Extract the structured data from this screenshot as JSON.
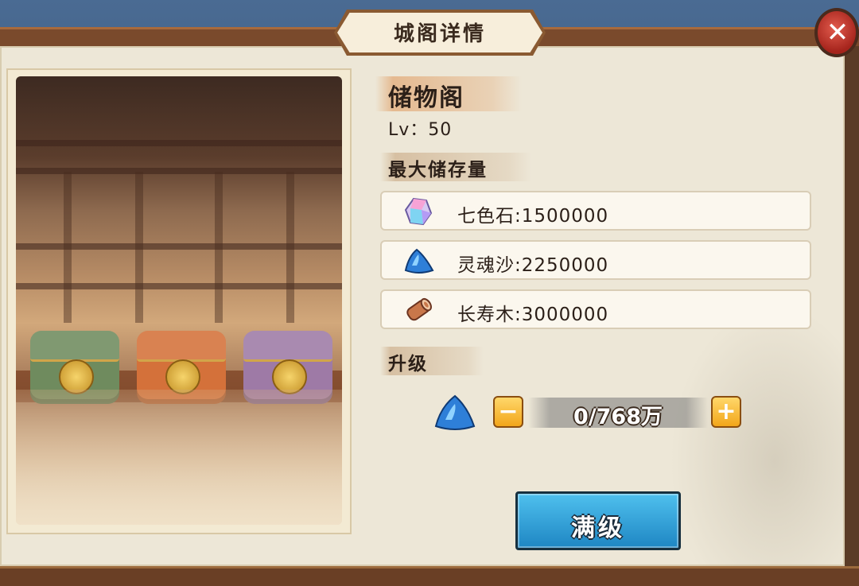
{
  "dialog": {
    "title": "城阁详情",
    "close_glyph": "✕"
  },
  "building": {
    "name": "储物阁",
    "level": "Lv：50"
  },
  "storage": {
    "section_title": "最大储存量",
    "items": [
      {
        "label": "七色石:1500000",
        "icon": "rainbow-gem-icon"
      },
      {
        "label": "灵魂沙:2250000",
        "icon": "soul-sand-icon"
      },
      {
        "label": "长寿木:3000000",
        "icon": "longevity-wood-icon"
      }
    ]
  },
  "upgrade": {
    "section_title": "升级",
    "icon": "soul-sand-icon",
    "minus_label": "−",
    "plus_label": "+",
    "quantity": "0/768万",
    "max_button_label": "满级"
  },
  "colors": {
    "button_blue": "#1e86c3",
    "stepper_yellow": "#f2a61b",
    "close_red": "#a5241c"
  }
}
